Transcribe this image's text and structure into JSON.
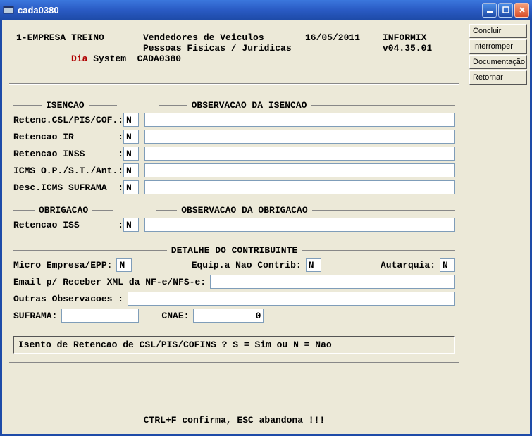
{
  "window": {
    "title": "cada0380"
  },
  "side_buttons": [
    "Concluir",
    "Interromper",
    "Documentação",
    "Retornar"
  ],
  "header": {
    "company": "1-EMPRESA TREINO",
    "subtitle": "Vendedores de Veiculos",
    "date": "16/05/2011",
    "db": "INFORMIX",
    "dia": "Dia",
    "system": "System  CADA0380",
    "line2_mid": "Pessoas Fisicas / Juridicas",
    "version": "v04.35.01"
  },
  "sections": {
    "isencao_title": "ISENCAO",
    "obs_isencao_title": "OBSERVACAO DA ISENCAO",
    "obrigacao_title": "OBRIGACAO",
    "obs_obrigacao_title": "OBSERVACAO DA OBRIGACAO",
    "detalhe_title": "DETALHE DO CONTRIBUINTE"
  },
  "fields": {
    "retenc_csl_label": "Retenc.CSL/PIS/COF.:",
    "retenc_csl_val": "N",
    "retenc_csl_obs": "",
    "retenc_ir_label": "Retencao IR        :",
    "retenc_ir_val": "N",
    "retenc_ir_obs": "",
    "retenc_inss_label": "Retencao INSS      :",
    "retenc_inss_val": "N",
    "retenc_inss_obs": "",
    "icms_op_label": "ICMS O.P./S.T./Ant.:",
    "icms_op_val": "N",
    "icms_op_obs": "",
    "desc_icms_label": "Desc.ICMS SUFRAMA  :",
    "desc_icms_val": "N",
    "desc_icms_obs": "",
    "retenc_iss_label": "Retencao ISS       :",
    "retenc_iss_val": "N",
    "retenc_iss_obs": "",
    "micro_label": "Micro Empresa/EPP:",
    "micro_val": "N",
    "equip_label": "Equip.a Nao Contrib:",
    "equip_val": "N",
    "autarquia_label": "Autarquia:",
    "autarquia_val": "N",
    "email_label": "Email p/ Receber XML da NF-e/NFS-e:",
    "email_val": "",
    "outras_label": "Outras Observacoes :",
    "outras_val": "",
    "suframa_label": "SUFRAMA:",
    "suframa_val": "",
    "cnae_label": "CNAE:",
    "cnae_val": "0"
  },
  "status": "Isento de Retencao de CSL/PIS/COFINS ?  S = Sim ou N = Nao",
  "footer": "CTRL+F confirma, ESC abandona !!!"
}
